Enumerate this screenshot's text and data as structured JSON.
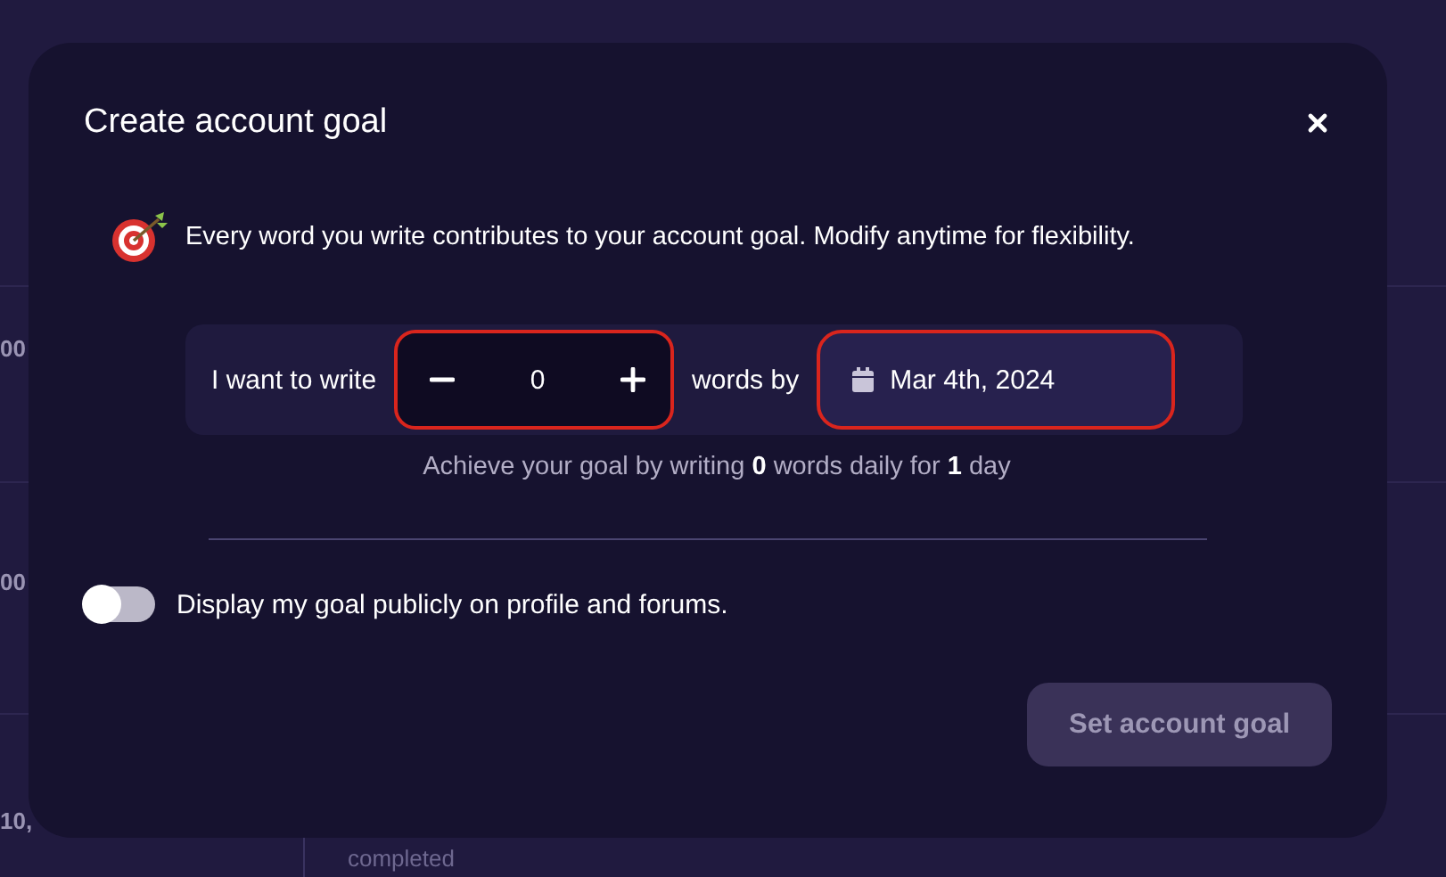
{
  "background_fragments": [
    {
      "text": "00"
    },
    {
      "text": "00"
    },
    {
      "text": "10,"
    },
    {
      "text": "completed"
    }
  ],
  "dialog": {
    "title": "Create account goal",
    "info": "Every word you write contributes to your account goal. Modify anytime for flexibility.",
    "goal": {
      "lead": "I want to write",
      "stepper_value": "0",
      "between": "words by",
      "date": "Mar 4th, 2024"
    },
    "summary": "Achieve your goal by writing **0** words daily for **1** day",
    "public_toggle": {
      "label": "Display my goal publicly on profile and forums.",
      "on": false
    },
    "submit": {
      "label": "Set account goal",
      "disabled": true
    }
  }
}
